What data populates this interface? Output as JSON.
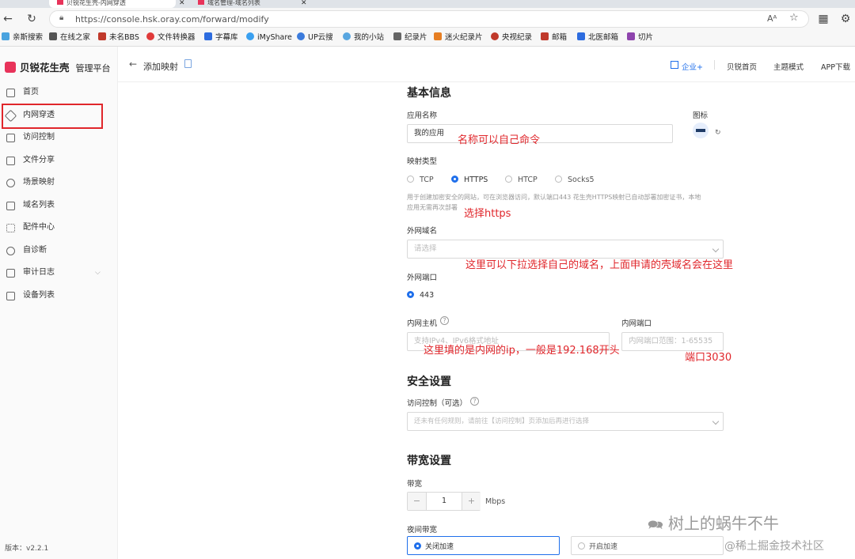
{
  "browser": {
    "tabs": [
      "贝锐花生壳-内网穿透",
      "域名管理-域名列表"
    ],
    "url": "https://console.hsk.oray.com/forward/modify",
    "bookmarks": [
      "亲斯搜索",
      "在线之家",
      "未名BBS",
      "文件转换器",
      "字幕库",
      "iMyShare",
      "UP云搜",
      "我的小站",
      "纪录片",
      "迷火纪录片",
      "央视纪录",
      "邮箱",
      "北医邮箱",
      "切片"
    ]
  },
  "sidebar": {
    "brand": "贝锐花生壳",
    "brand_sub": "管理平台",
    "items": [
      {
        "label": "首页",
        "icon": "home-icon"
      },
      {
        "label": "内网穿透",
        "icon": "cube-icon"
      },
      {
        "label": "访问控制",
        "icon": "access-icon"
      },
      {
        "label": "文件分享",
        "icon": "folder-icon"
      },
      {
        "label": "场景映射",
        "icon": "scene-icon"
      },
      {
        "label": "域名列表",
        "icon": "domain-icon"
      },
      {
        "label": "配件中心",
        "icon": "grid-icon"
      },
      {
        "label": "自诊断",
        "icon": "diagnose-icon"
      },
      {
        "label": "审计日志",
        "icon": "log-icon"
      },
      {
        "label": "设备列表",
        "icon": "device-icon"
      }
    ],
    "version": "版本：v2.2.1"
  },
  "topbar": {
    "back_title": "添加映射",
    "links": [
      "企业+",
      "贝锐首页",
      "主题模式",
      "APP下载"
    ]
  },
  "form": {
    "basic_title": "基本信息",
    "app_name_label": "应用名称",
    "app_name_value": "我的应用",
    "icon_label": "图标",
    "map_type_label": "映射类型",
    "map_types": [
      "TCP",
      "HTTPS",
      "HTCP",
      "Socks5"
    ],
    "map_type_selected": "HTTPS",
    "hint_line1": "用于创建加密安全的网站，可在浏览器访问，默认端口443 花生壳HTTPS映射已自动部署加密证书，本地",
    "hint_line2": "应用无需再次部署",
    "domain_label": "外网域名",
    "domain_placeholder": "请选择",
    "ext_port_label": "外网端口",
    "ext_port_value": "443",
    "host_label": "内网主机",
    "host_placeholder": "支持IPv4、IPv6格式地址",
    "inner_port_label": "内网端口",
    "inner_port_placeholder": "内网端口范围：1-65535",
    "security_title": "安全设置",
    "access_label": "访问控制（可选）",
    "access_placeholder": "还未有任何规则，请前往【访问控制】页添加后再进行选择",
    "bandwidth_title": "带宽设置",
    "bandwidth_label": "带宽",
    "bandwidth_value": "1",
    "bandwidth_unit": "Mbps",
    "night_label": "夜间带宽",
    "night_off": "关闭加速",
    "night_on": "开启加速"
  },
  "annotations": {
    "name": "名称可以自己命令",
    "https": "选择https",
    "domain": "这里可以下拉选择自己的域名，上面申请的壳域名会在这里",
    "host": "这里填的是内网的ip，一般是192.168开头",
    "port": "端口3030"
  },
  "watermarks": [
    "树上的蜗牛不牛",
    "@稀土掘金技术社区"
  ]
}
